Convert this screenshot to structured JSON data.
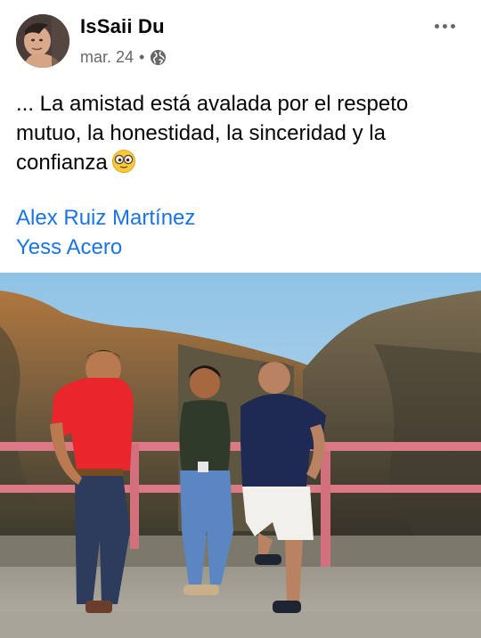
{
  "post": {
    "author": "IsSaii Du",
    "date": "mar. 24",
    "separator": "•",
    "privacy_icon": "globe-icon",
    "menu_icon": "more-options-icon",
    "text": "... La amistad está avalada por el respeto mutuo, la honestidad, la sinceridad y la confianza",
    "emoji": "nerd-glasses-emoji",
    "tagged": [
      {
        "name": "Alex Ruiz Martínez"
      },
      {
        "name": "Yess Acero"
      }
    ],
    "photo_icon": "post-photo"
  },
  "colors": {
    "link": "#1b74e4",
    "meta": "#65676b",
    "text": "#050505"
  }
}
